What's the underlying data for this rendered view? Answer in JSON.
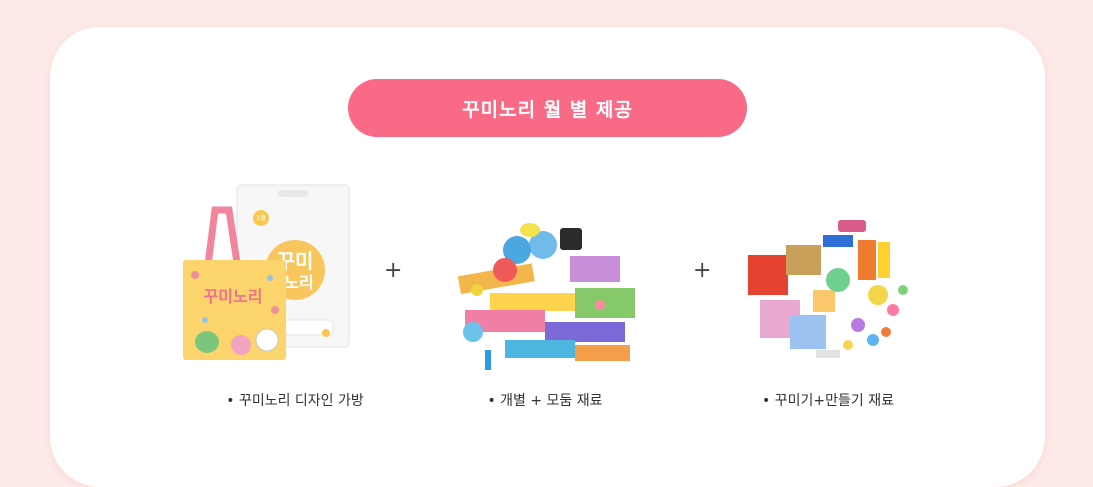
{
  "section": {
    "title": "꾸미노리 월 별 제공"
  },
  "items": [
    {
      "caption": "• 꾸미노리 디자인 가방",
      "image_icon": "design-bag-image",
      "bag_text": "꾸미노리",
      "bag_badge": "1월"
    },
    {
      "caption": "• 개별 + 모둠 재료",
      "image_icon": "art-supplies-image"
    },
    {
      "caption": "• 꾸미기+만들기 재료",
      "image_icon": "craft-materials-image"
    }
  ],
  "separators": [
    "+",
    "+"
  ],
  "colors": {
    "background": "#fdeae7",
    "card": "#ffffff",
    "accent": "#f96a86",
    "text": "#333333"
  }
}
